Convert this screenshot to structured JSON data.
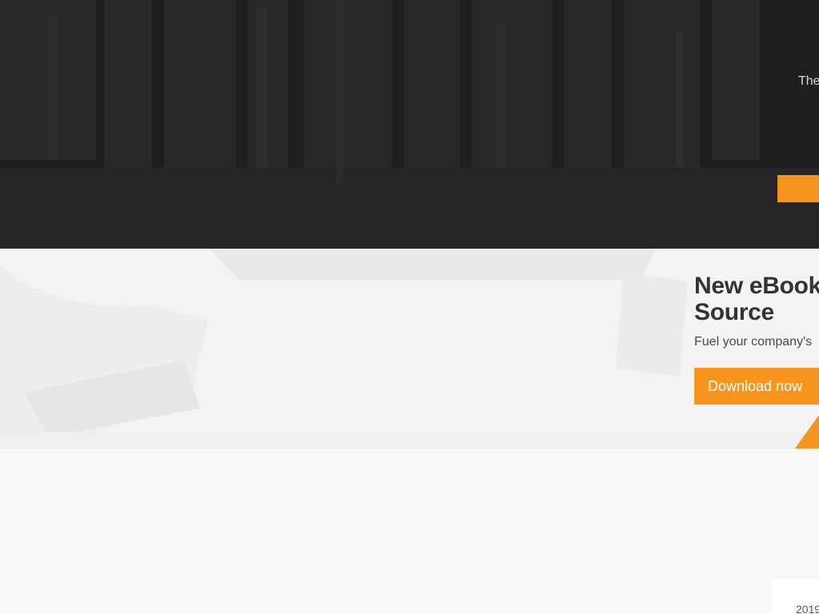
{
  "hero": {
    "text_fragment": "The",
    "button_label": ""
  },
  "promo": {
    "title_line1": "New eBook",
    "title_line2": "Source",
    "subtitle": "Fuel your company's",
    "cta_label": "Download now"
  },
  "card": {
    "year_fragment": "2019"
  },
  "colors": {
    "accent": "#f7941d",
    "hero_bg": "#1f1f20",
    "page_bg": "#f8f8f8",
    "heading": "#333333"
  }
}
